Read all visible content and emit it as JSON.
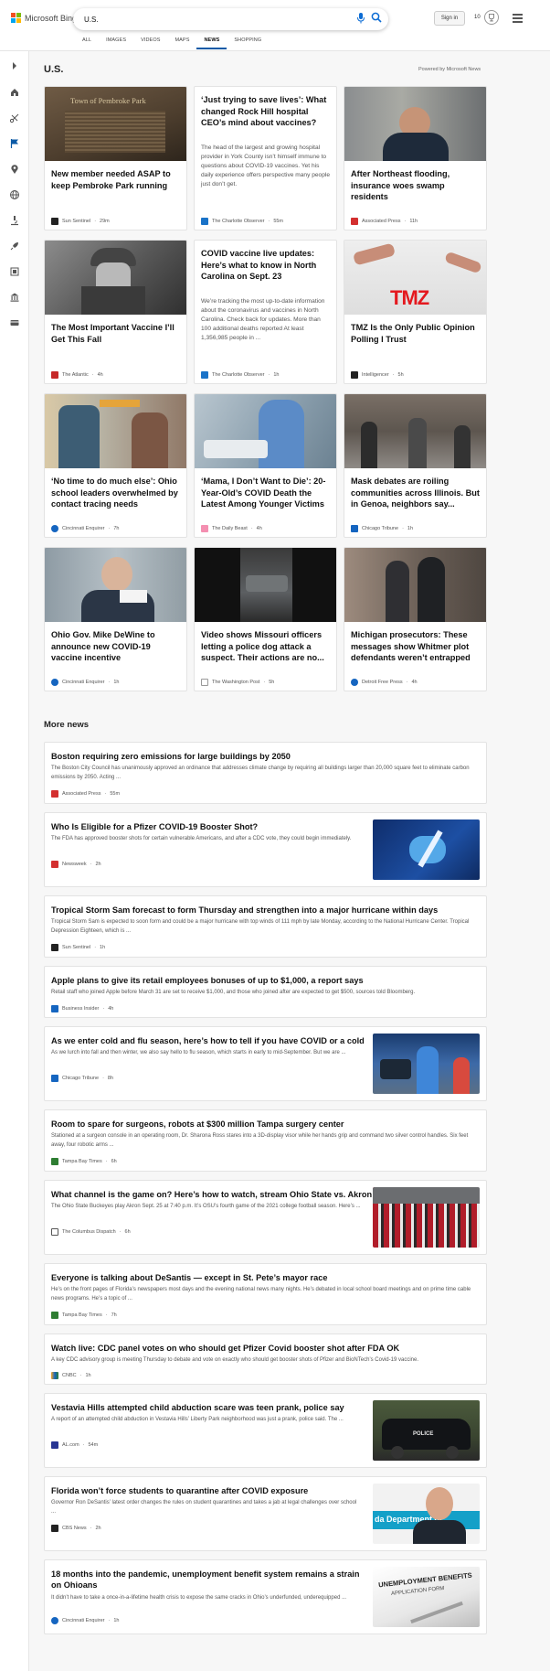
{
  "header": {
    "logo_text": "Microsoft Bing",
    "search_value": "U.S.",
    "signin_label": "Sign in",
    "rewards_count": "10",
    "tabs": [
      {
        "label": "ALL"
      },
      {
        "label": "IMAGES"
      },
      {
        "label": "VIDEOS"
      },
      {
        "label": "MAPS"
      },
      {
        "label": "NEWS"
      },
      {
        "label": "SHOPPING"
      }
    ],
    "active_tab": "NEWS"
  },
  "rail": {
    "icons": [
      "chevron-right-icon",
      "home-icon",
      "scissors-icon",
      "flag-icon",
      "location-pin-icon",
      "globe-icon",
      "microscope-icon",
      "rocket-icon",
      "film-icon",
      "bank-icon",
      "credit-card-icon"
    ]
  },
  "section": {
    "title": "U.S.",
    "powered_by": "Powered by Microsoft News"
  },
  "cards": [
    {
      "title": "New member needed ASAP to keep Pembroke Park running",
      "source": "Sun Sentinel",
      "time": "29m",
      "src_color": "#222222",
      "img_text": "Town of Pembroke Park"
    },
    {
      "title": "‘Just trying to save lives’: What changed Rock Hill hospital CEO’s mind about vaccines?",
      "desc": "The head of the largest and growing hospital provider in York County isn’t himself immune to questions about COVID-19 vaccines. Yet his daily experience offers perspective many people just don’t get.",
      "source": "The Charlotte Observer",
      "time": "55m",
      "src_color": "#1a73c8"
    },
    {
      "title": "After Northeast flooding, insurance woes swamp residents",
      "source": "Associated Press",
      "time": "11h",
      "src_color": "#d32f2f"
    },
    {
      "title": "The Most Important Vaccine I’ll Get This Fall",
      "source": "The Atlantic",
      "time": "4h",
      "src_color": "#c62828"
    },
    {
      "title": "COVID vaccine live updates: Here’s what to know in North Carolina on Sept. 23",
      "desc": "We’re tracking the most up-to-date information about the coronavirus and vaccines in North Carolina. Check back for updates. More than 100 additional deaths reported At least 1,356,985 people in ...",
      "source": "The Charlotte Observer",
      "time": "1h",
      "src_color": "#1a73c8"
    },
    {
      "title": "TMZ Is the Only Public Opinion Polling I Trust",
      "source": "Intelligencer",
      "time": "5h",
      "src_color": "#222222",
      "img_text": "TMZ"
    },
    {
      "title": "‘No time to do much else’: Ohio school leaders overwhelmed by contact tracing needs",
      "source": "Cincinnati Enquirer",
      "time": "7h",
      "src_color": "#1565c0"
    },
    {
      "title": "‘Mama, I Don’t Want to Die’: 20-Year-Old’s COVID Death the Latest Among Younger Victims",
      "source": "The Daily Beast",
      "time": "4h",
      "src_color": "#f48fb1"
    },
    {
      "title": "Mask debates are roiling communities across Illinois. But in Genoa, neighbors say...",
      "source": "Chicago Tribune",
      "time": "1h",
      "src_color": "#1565c0"
    },
    {
      "title": "Ohio Gov. Mike DeWine to announce new COVID-19 vaccine incentive",
      "source": "Cincinnati Enquirer",
      "time": "1h",
      "src_color": "#1565c0"
    },
    {
      "title": "Video shows Missouri officers letting a police dog attack a suspect. Their actions are no...",
      "source": "The Washington Post",
      "time": "5h",
      "src_color": "#222222",
      "src_abbr": "wp"
    },
    {
      "title": "Michigan prosecutors: These messages show Whitmer plot defendants weren’t entrapped",
      "source": "Detroit Free Press",
      "time": "4h",
      "src_color": "#1565c0"
    }
  ],
  "more": {
    "title": "More news",
    "items": [
      {
        "title": "Boston requiring zero emissions for large buildings by 2050",
        "desc": "The Boston City Council has unanimously approved an ordinance that addresses climate change by requiring all buildings larger than 20,000 square feet to eliminate carbon emissions by 2050. Acting ...",
        "source": "Associated Press",
        "time": "55m",
        "src_color": "#d32f2f"
      },
      {
        "title": "Who Is Eligible for a Pfizer COVID-19 Booster Shot?",
        "desc": "The FDA has approved booster shots for certain vulnerable Americans, and after a CDC vote, they could begin immediately.",
        "source": "Newsweek",
        "time": "2h",
        "src_color": "#d32f2f"
      },
      {
        "title": "Tropical Storm Sam forecast to form Thursday and strengthen into a major hurricane within days",
        "desc": "Tropical Storm Sam is expected to soon form and could be a major hurricane with top winds of 111 mph by late Monday, according to the National Hurricane Center. Tropical Depression Eighteen, which is ...",
        "source": "Sun Sentinel",
        "time": "1h",
        "src_color": "#222222"
      },
      {
        "title": "Apple plans to give its retail employees bonuses of up to $1,000, a report says",
        "desc": "Retail staff who joined Apple before March 31 are set to receive $1,000, and those who joined after are expected to get $500, sources told Bloomberg.",
        "source": "Business Insider",
        "time": "4h",
        "src_color": "#1565c0"
      },
      {
        "title": "As we enter cold and flu season, here’s how to tell if you have COVID or a cold",
        "desc": "As we lurch into fall and then winter, we also say hello to flu season, which starts in early to mid-September. But we are ...",
        "source": "Chicago Tribune",
        "time": "8h",
        "src_color": "#1565c0"
      },
      {
        "title": "Room to spare for surgeons, robots at $300 million Tampa surgery center",
        "desc": "Stationed at a surgeon console in an operating room, Dr. Sharona Ross stares into a 3D-display visor while her hands grip and command two silver control handles. Six feet away, four robotic arms ...",
        "source": "Tampa Bay Times",
        "time": "6h",
        "src_color": "#2e7d32"
      },
      {
        "title": "What channel is the game on? Here’s how to watch, stream Ohio State vs. Akron",
        "desc": "The Ohio State Buckeyes play Akron Sept. 25 at 7:40 p.m. It’s OSU’s fourth game of the 2021 college football season. Here’s ...",
        "source": "The Columbus Dispatch",
        "time": "6h",
        "src_color": "#222222"
      },
      {
        "title": "Everyone is talking about DeSantis — except in St. Pete’s mayor race",
        "desc": "He’s on the front pages of Florida’s newspapers most days and the evening national news many nights. He’s debated in local school board meetings and on prime time cable news programs. He’s a topic of ...",
        "source": "Tampa Bay Times",
        "time": "7h",
        "src_color": "#2e7d32"
      },
      {
        "title": "Watch live: CDC panel votes on who should get Pfizer Covid booster shot after FDA OK",
        "desc": "A key CDC advisory group is meeting Thursday to debate and vote on exactly who should get booster shots of Pfizer and BioNTech’s Covid-19 vaccine.",
        "source": "CNBC",
        "time": "1h",
        "src_color": "#f9a825"
      },
      {
        "title": "Vestavia Hills attempted child abduction scare was teen prank, police say",
        "desc": "A report of an attempted child abduction in Vestavia Hills’ Liberty Park neighborhood was just a prank, police said. The ...",
        "source": "AL.com",
        "time": "54m",
        "src_color": "#283593"
      },
      {
        "title": "Florida won’t force students to quarantine after COVID exposure",
        "desc": "Governor Ron DeSantis’ latest order changes the rules on student quarantines and takes a jab at legal challenges over school ...",
        "source": "CBS News",
        "time": "2h",
        "src_color": "#222222"
      },
      {
        "title": "18 months into the pandemic, unemployment benefit system remains a strain on Ohioans",
        "desc": "It didn’t have to take a once-in-a-lifetime health crisis to expose the same cracks in Ohio’s underfunded, underequipped ...",
        "source": "Cincinnati Enquirer",
        "time": "1h",
        "src_color": "#1565c0"
      }
    ]
  },
  "image_text": {
    "tmz": "TMZ",
    "police": "POLICE",
    "unemployment": "UNEMPLOYMENT BENEFITS",
    "application": "APPLICATION FORM",
    "desantis_banner": "da Department of"
  }
}
